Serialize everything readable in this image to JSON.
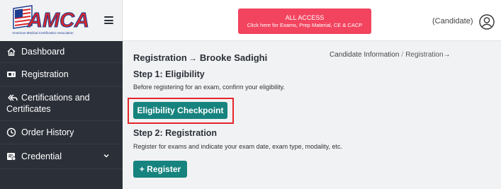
{
  "logo": {
    "icon": "amca-logo",
    "tagline": "American Medical Certification Association"
  },
  "sidebar": {
    "items": [
      {
        "label": "Dashboard",
        "icon": "home-icon"
      },
      {
        "label": "Registration",
        "icon": "ticket-icon"
      },
      {
        "label": "Certifications and Certificates",
        "icon": "reply-all-icon"
      },
      {
        "label": "Order History",
        "icon": "clock-icon"
      },
      {
        "label": "Credential",
        "icon": "credential-icon"
      }
    ]
  },
  "topbar": {
    "access_title": "ALL ACCESS",
    "access_sub": "Click here for Exams, Prep Material, CE & CACP",
    "role": "(Candidate)"
  },
  "main": {
    "title_prefix": "Registration",
    "title_arrow": "→",
    "title_name": "Brooke Sadighi",
    "breadcrumb": {
      "first": "Candidate Information",
      "separator": "/",
      "second": "Registration",
      "arrow": "→"
    },
    "step1_title": "Step 1: Eligibility",
    "step1_desc": "Before registering for an exam, confirm your eligibility.",
    "eligibility_button": "Eligibility Checkpoint",
    "step2_title": "Step 2: Registration",
    "step2_desc": "Register for exams and indicate your exam date, exam type, modality, etc.",
    "register_button": "+ Register"
  },
  "colors": {
    "sidebar": "#2b3038",
    "accent": "#17837e",
    "access": "#f2445f",
    "highlight": "#e5262c"
  }
}
